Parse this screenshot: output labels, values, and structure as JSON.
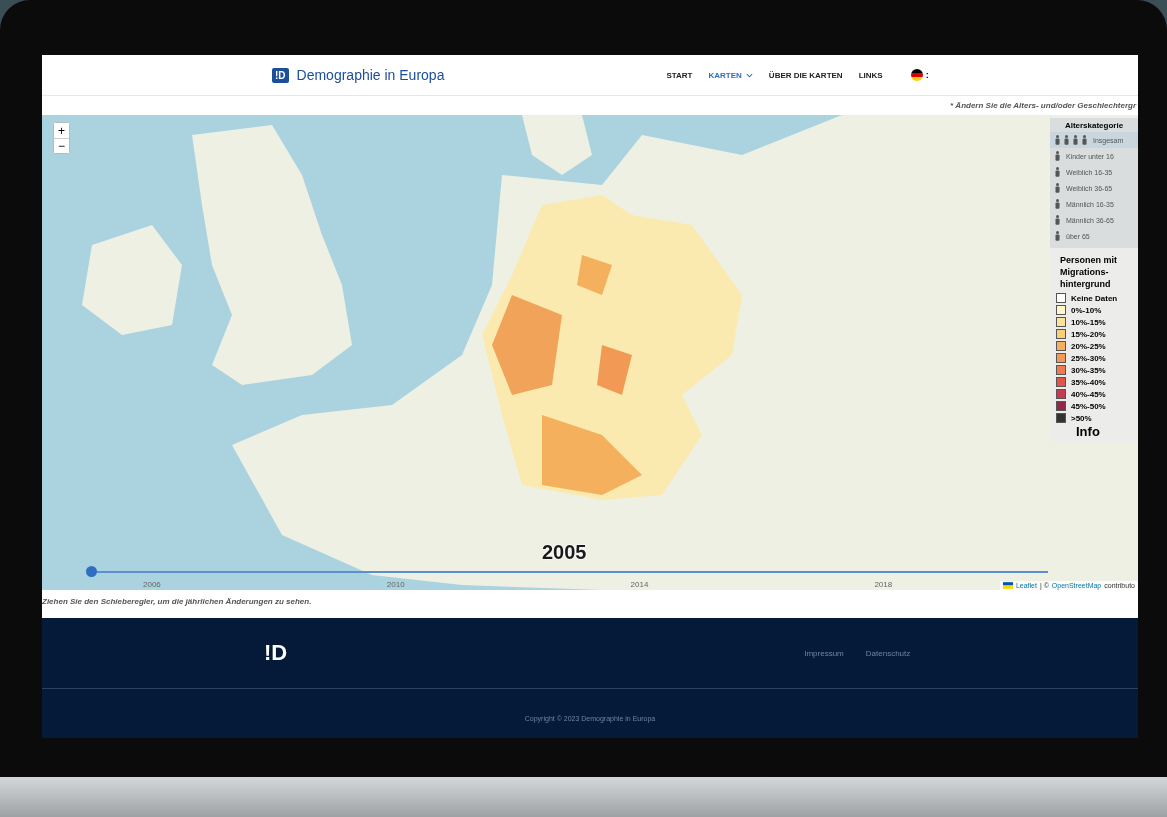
{
  "header": {
    "logo_mark": "!D",
    "title": "Demographie in Europa",
    "nav": [
      {
        "label": "START",
        "selected": false,
        "dropdown": false
      },
      {
        "label": "KARTEN",
        "selected": true,
        "dropdown": true
      },
      {
        "label": "ÜBER DIE KARTEN",
        "selected": false,
        "dropdown": false
      },
      {
        "label": "LINKS",
        "selected": false,
        "dropdown": false
      }
    ],
    "language_caret": ":"
  },
  "notice": "* Ändern Sie die Alters- und/oder Geschlechtergr",
  "map": {
    "zoom_in": "+",
    "zoom_out": "−",
    "year": "2005",
    "slider": {
      "level": 0,
      "ticks": [
        "2006",
        "2010",
        "2014",
        "2018"
      ]
    },
    "attribution": {
      "leaflet": "Leaflet",
      "separator": "| ©",
      "osm": "OpenStreetMap",
      "rest": "contributo"
    },
    "age_legend": {
      "title": "Alterskategorie",
      "items": [
        {
          "label": "Insgesam",
          "selected": true
        },
        {
          "label": "Kinder unter 16",
          "selected": false
        },
        {
          "label": "Weiblich 16-35",
          "selected": false
        },
        {
          "label": "Weiblich 36-65",
          "selected": false
        },
        {
          "label": "Männlich 16-35",
          "selected": false
        },
        {
          "label": "Männlich 36-65",
          "selected": false
        },
        {
          "label": "über 65",
          "selected": false
        }
      ]
    },
    "color_legend": {
      "title": "Personen mit Migrations-hintergrund",
      "classes": [
        {
          "label": "Keine Daten",
          "color": "#ffffff"
        },
        {
          "label": "0%-10%",
          "color": "#fff6cc"
        },
        {
          "label": "10%-15%",
          "color": "#fbe49a"
        },
        {
          "label": "15%-20%",
          "color": "#f6cf78"
        },
        {
          "label": "20%-25%",
          "color": "#f4b05c"
        },
        {
          "label": "25%-30%",
          "color": "#f29a55"
        },
        {
          "label": "30%-35%",
          "color": "#ee7b4e"
        },
        {
          "label": "35%-40%",
          "color": "#e05548"
        },
        {
          "label": "40%-45%",
          "color": "#c63b4f"
        },
        {
          "label": "45%-50%",
          "color": "#8e2a48"
        },
        {
          "label": ">50%",
          "color": "#333333"
        }
      ],
      "info": "Info"
    }
  },
  "caption": "Ziehen Sie den Schieberegler, um die jährlichen Änderungen zu sehen.",
  "footer": {
    "logo_mark": "!D",
    "links": [
      "Impressum",
      "Datenschutz"
    ],
    "copyright": "Copyright © 2023 Demographie in Europa"
  }
}
